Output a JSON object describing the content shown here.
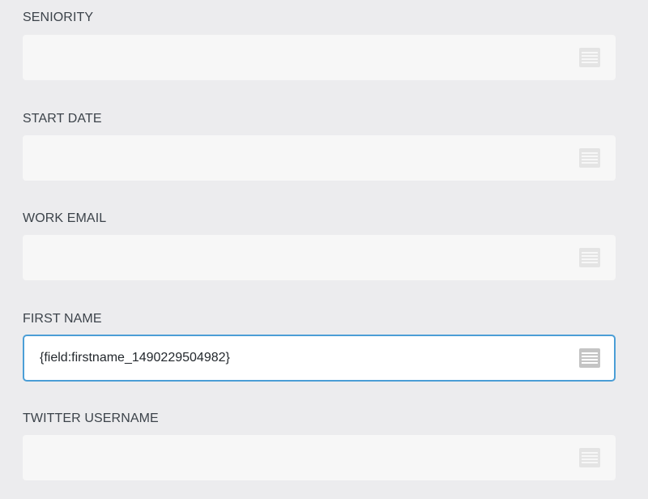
{
  "fields": [
    {
      "label": "SENIORITY",
      "value": "",
      "icon": "merge-tags-icon"
    },
    {
      "label": "START DATE",
      "value": "",
      "icon": "merge-tags-icon"
    },
    {
      "label": "WORK EMAIL",
      "value": "",
      "icon": "merge-tags-icon"
    },
    {
      "label": "FIRST NAME",
      "value": "{field:firstname_1490229504982}",
      "icon": "merge-tags-icon"
    },
    {
      "label": "TWITTER USERNAME",
      "value": "",
      "icon": "merge-tags-icon"
    }
  ],
  "colors": {
    "background": "#ececee",
    "input_background": "#f7f7f7",
    "focus_border": "#4b9ed6",
    "label_text": "#3c434a"
  }
}
